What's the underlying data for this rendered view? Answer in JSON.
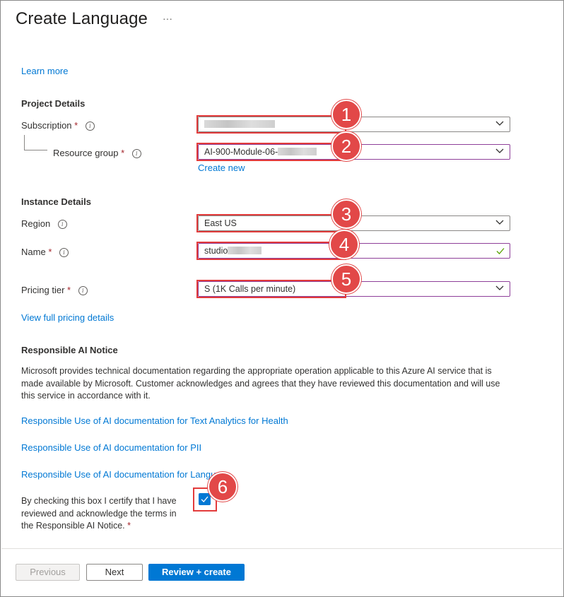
{
  "header": {
    "title": "Create Language",
    "more": "···"
  },
  "learn_more": "Learn more",
  "project_details": {
    "heading": "Project Details",
    "subscription": {
      "label": "Subscription",
      "required": "*",
      "value": ""
    },
    "resource_group": {
      "label": "Resource group",
      "required": "*",
      "value": "AI-900-Module-06-"
    },
    "create_new": "Create new"
  },
  "instance_details": {
    "heading": "Instance Details",
    "region": {
      "label": "Region",
      "value": "East US"
    },
    "name": {
      "label": "Name",
      "required": "*",
      "value": "studio"
    },
    "pricing_tier": {
      "label": "Pricing tier",
      "required": "*",
      "value": "S (1K Calls per minute)"
    },
    "view_pricing": "View full pricing details"
  },
  "responsible_ai": {
    "heading": "Responsible AI Notice",
    "body": "Microsoft provides technical documentation regarding the appropriate operation applicable to this Azure AI service that is made available by Microsoft. Customer acknowledges and agrees that they have reviewed this documentation and will use this service in accordance with it.",
    "links": [
      "Responsible Use of AI documentation for Text Analytics for Health",
      "Responsible Use of AI documentation for PII",
      "Responsible Use of AI documentation for Langu"
    ],
    "certify_text": "By checking this box I certify that I have reviewed and acknowledge the terms in the Responsible AI Notice.",
    "certify_required": "*",
    "certify_checked": true
  },
  "callouts": [
    "1",
    "2",
    "3",
    "4",
    "5",
    "6"
  ],
  "footer": {
    "previous": "Previous",
    "next": "Next",
    "review_create": "Review + create"
  },
  "colors": {
    "accent": "#0078d4",
    "callout": "#e24848",
    "required": "#a4262c",
    "valid": "#57a300",
    "focus_border": "#8e3f99"
  }
}
